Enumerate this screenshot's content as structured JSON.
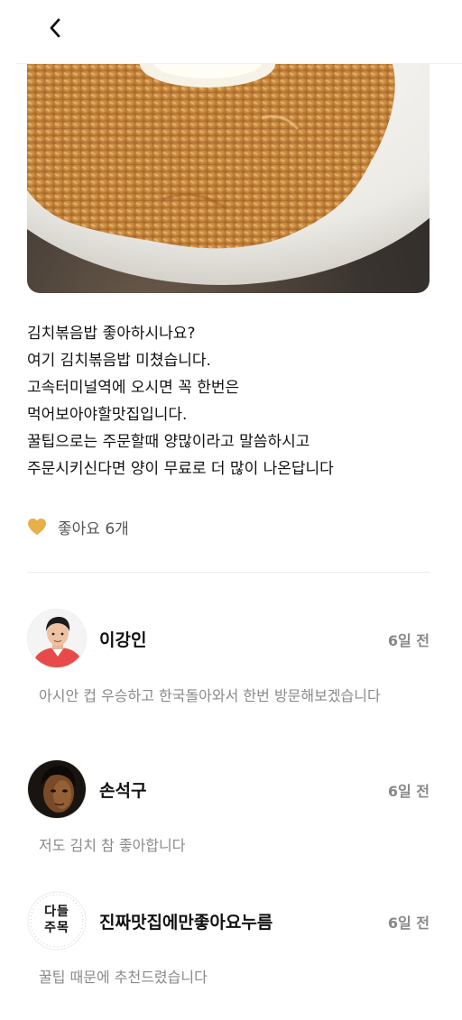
{
  "header": {
    "back_icon": "chevron-left-icon"
  },
  "post": {
    "lines": [
      "김치볶음밥 좋아하시나요?",
      "여기 김치볶음밥 미쳤습니다.",
      "고속터미널역에 오시면 꼭 한번은",
      "먹어보아야할맛집입니다.",
      "꿀팁으로는 주문할때 양많이라고 말씀하시고",
      "주문시키신다면 양이 무료로 더 많이 나온답니다"
    ],
    "likes_label": "좋아요 6개",
    "heart_color": "#E8B04A"
  },
  "comments": [
    {
      "name": "이강인",
      "time": "6일 전",
      "text": "아시안 컵 우승하고 한국돌아와서 한번 방문해보겠습니다"
    },
    {
      "name": "손석구",
      "time": "6일 전",
      "text": "저도 김치 참 좋아합니다"
    },
    {
      "name": "진짜맛집에만좋아요누름",
      "time": "6일 전",
      "text": "꿀팁 때문에 추천드렸습니다",
      "avatar_text": "다들 주목"
    }
  ]
}
